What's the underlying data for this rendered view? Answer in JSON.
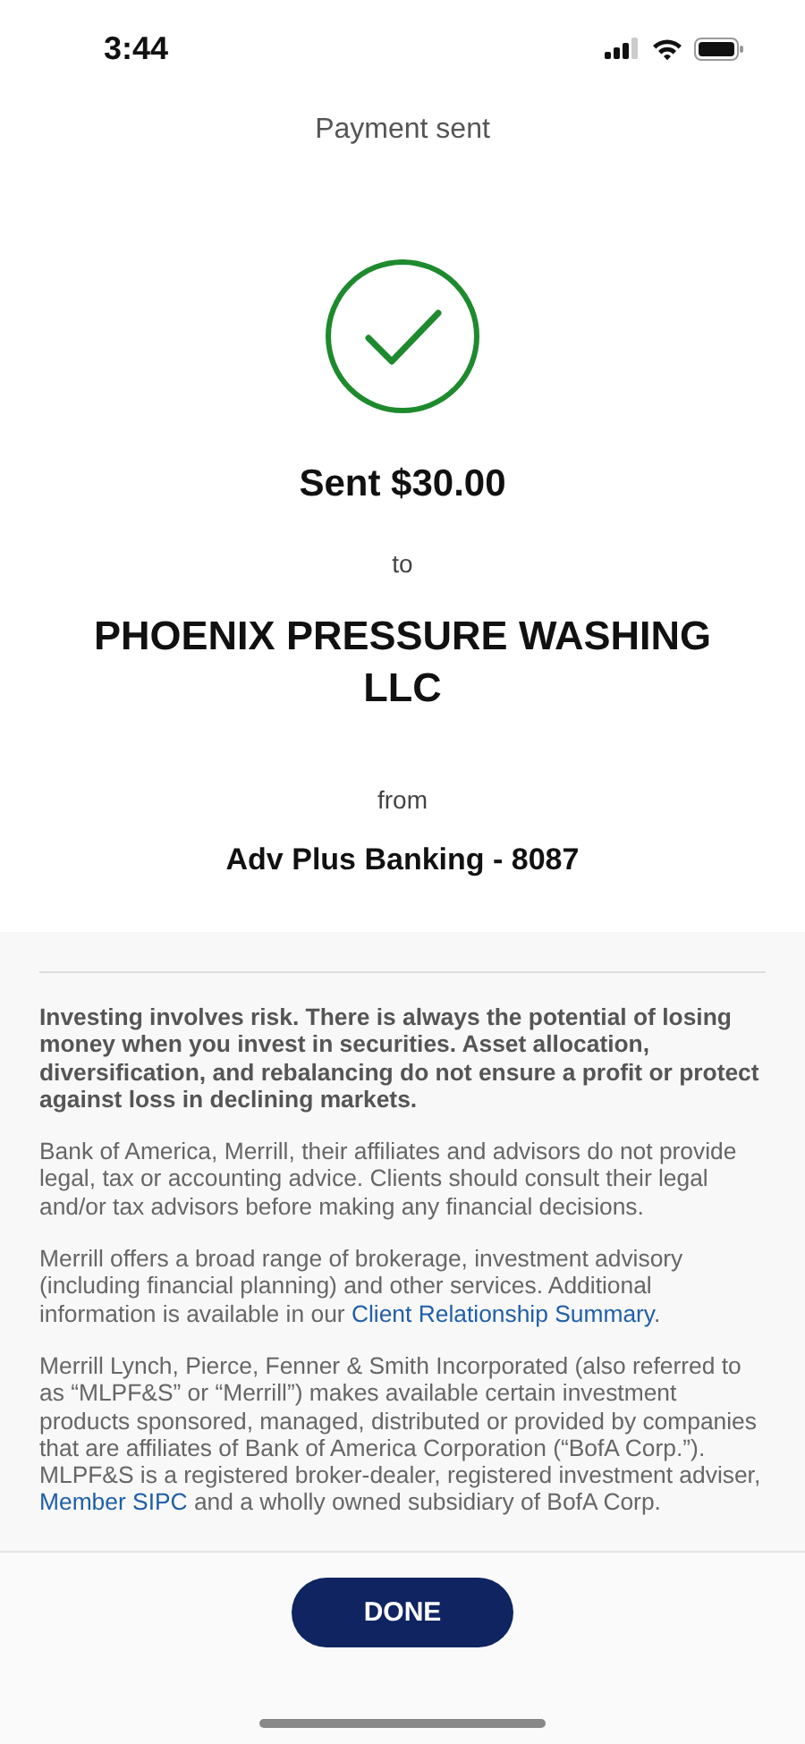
{
  "status_bar": {
    "time": "3:44"
  },
  "header": {
    "title": "Payment sent"
  },
  "confirmation": {
    "amount": "Sent $30.00",
    "to_label": "to",
    "payee": "PHOENIX PRESSURE WASHING LLC",
    "from_label": "from",
    "account": "Adv Plus Banking - 8087"
  },
  "disclosures": [
    {
      "kind": "bold",
      "parts": [
        {
          "text": "Investing involves risk. There is always the potential of losing money when you invest in securities. Asset allocation, diversification, and rebalancing do not ensure a profit or protect against loss in declining markets."
        }
      ]
    },
    {
      "kind": "plain",
      "parts": [
        {
          "text": "Bank of America, Merrill, their affiliates and advisors do not provide legal, tax or accounting advice. Clients should consult their legal and/or tax advisors before making any financial decisions."
        }
      ]
    },
    {
      "kind": "plain",
      "parts": [
        {
          "text": "Merrill offers a broad range of brokerage, investment advisory (including financial planning) and other services. Additional information is available in our "
        },
        {
          "text": "Client Relationship Summary",
          "link": true
        },
        {
          "text": "."
        }
      ]
    },
    {
      "kind": "plain",
      "parts": [
        {
          "text": "Merrill Lynch, Pierce, Fenner & Smith Incorporated (also referred to as “MLPF&S” or “Merrill”) makes available certain investment products sponsored, managed, distributed or provided by companies that are affiliates of Bank of America Corporation (“BofA Corp.”). MLPF&S is a registered broker-dealer, registered investment adviser, "
        },
        {
          "text": "Member SIPC",
          "link": true
        },
        {
          "text": " and a wholly owned subsidiary of BofA Corp."
        }
      ]
    }
  ],
  "footer": {
    "button": "DONE"
  }
}
